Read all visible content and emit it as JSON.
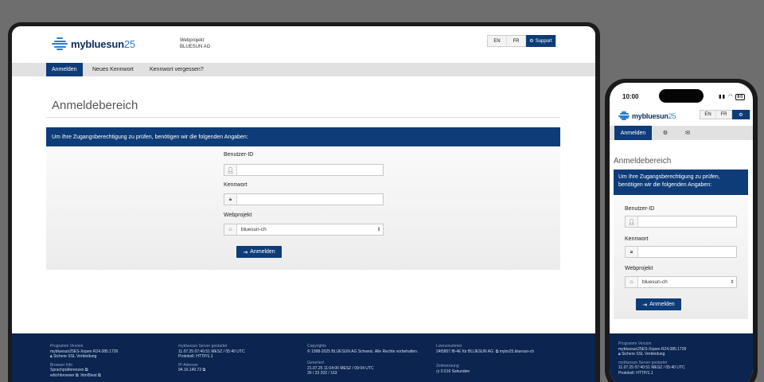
{
  "brand": {
    "logo_bold": "mybluesun",
    "logo_light": "25"
  },
  "header": {
    "project_label": "Webprojekt",
    "project_name": "BLUESUN AG",
    "lang_en": "EN",
    "lang_fr": "FR",
    "support_label": "Support"
  },
  "tabs": {
    "login": "Anmelden",
    "new_password": "Neues Kennwort",
    "forgot_password": "Kennwort vergessen?"
  },
  "main": {
    "title": "Anmeldebereich",
    "info": "Um Ihre Zugangsberechtigung zu prüfen, benötigen wir die folgenden Angaben:"
  },
  "form": {
    "user_id_label": "Benutzer-ID",
    "user_id_value": "",
    "password_label": "Kennwort",
    "password_value": "",
    "project_label": "Webprojekt",
    "project_value": "bluesun-ch",
    "submit_label": "Anmelden"
  },
  "footer": {
    "program_heading": "Programm Version",
    "program_value": "mybluesun25ES-Xopen R24.085.1726",
    "ssl": "Sichere SSL Verbindung",
    "browser_heading": "Browser Info",
    "browser_lang": "Sprachpräferenzen",
    "browser_which": "whichbrowser",
    "browser_html": "html5test",
    "server_heading": "mybluesun Server gestartet",
    "server_value": "11.07.25 07:40:51 MESZ / 05:40 UTC",
    "protocol": "Protokoll: HTTP/1.1",
    "ip_heading": "IP-Adresse",
    "ip_value": "94.16.140.72",
    "copyright_heading": "Copyrights",
    "copyright_value": "1998-2025 BLUESUN AG Schweiz. Alle Rechte vorbehalten.",
    "generated_heading": "Generiert",
    "generated_value": "21.07.25 11:04:06 MESZ / 09:04 UTC",
    "generated_counts": "30 / 23     202 / 163",
    "license_heading": "Lizenznummer",
    "license_value": "24t5807.f8-4E für BLUESUN AG",
    "license_host": "mybs25.bluesun-ch",
    "timing_heading": "Zeitmessung",
    "timing_value": "0.016 Sekunden"
  },
  "phone": {
    "time": "10:00",
    "battery": "80",
    "info_line1": "Um Ihre Zugangsberechtigung zu prüfen,",
    "info_line2": "benötigen wir die folgenden Angaben:",
    "program_value": "mybluesun25ES-Xopen R24.085.1726"
  },
  "colors": {
    "brand_navy": "#0d3c78",
    "footer_navy": "#0b2450",
    "logo_blue": "#2f7fc8"
  }
}
